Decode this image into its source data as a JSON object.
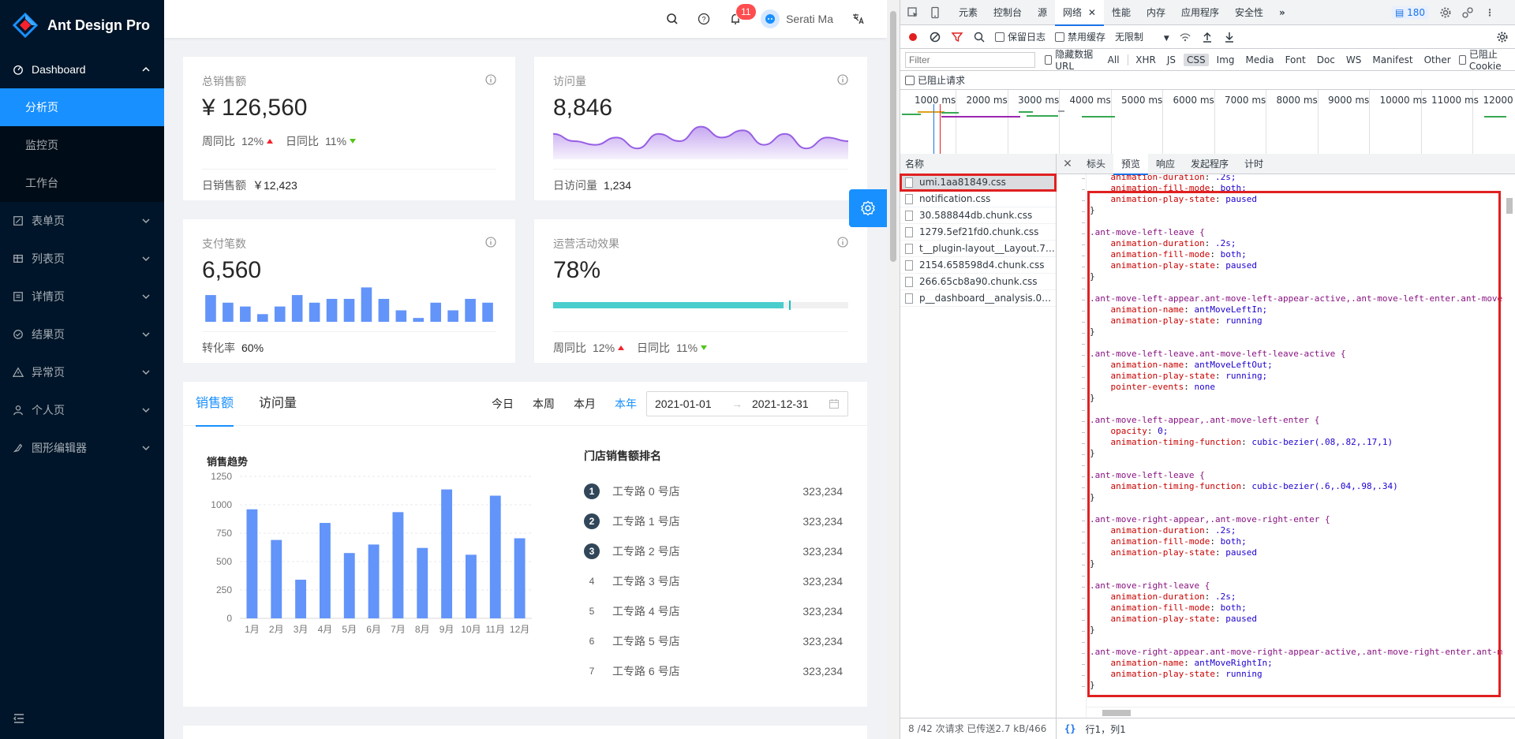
{
  "app": {
    "name": "Ant Design Pro"
  },
  "sidebar": {
    "items": [
      {
        "label": "Dashboard",
        "open": true,
        "icon": "dashboard-icon"
      },
      {
        "label": "表单页",
        "icon": "form-icon"
      },
      {
        "label": "列表页",
        "icon": "table-icon"
      },
      {
        "label": "详情页",
        "icon": "profile-icon"
      },
      {
        "label": "结果页",
        "icon": "check-circle-icon"
      },
      {
        "label": "异常页",
        "icon": "warning-icon"
      },
      {
        "label": "个人页",
        "icon": "user-icon"
      },
      {
        "label": "图形编辑器",
        "icon": "highlight-icon"
      }
    ],
    "subitems": [
      {
        "label": "分析页",
        "active": true
      },
      {
        "label": "监控页"
      },
      {
        "label": "工作台"
      }
    ]
  },
  "header": {
    "notice_count": "11",
    "user_name": "Serati Ma"
  },
  "stats": {
    "sales": {
      "title": "总销售额",
      "value": "¥ 126,560",
      "week_label": "周同比",
      "week_value": "12%",
      "day_label": "日同比",
      "day_value": "11%",
      "footer_label": "日销售额",
      "footer_value": "￥12,423"
    },
    "visits": {
      "title": "访问量",
      "value": "8,846",
      "footer_label": "日访问量",
      "footer_value": "1,234",
      "area_values": [
        7,
        5,
        4,
        6,
        3,
        7,
        5,
        9,
        6,
        8,
        4,
        7,
        3,
        6,
        5
      ]
    },
    "payments": {
      "title": "支付笔数",
      "value": "6,560",
      "footer_label": "转化率",
      "footer_value": "60%",
      "bar_values": [
        7,
        5,
        4,
        2,
        4,
        7,
        5,
        6,
        6,
        9,
        6,
        3,
        1,
        5,
        3,
        6,
        5
      ]
    },
    "operations": {
      "title": "运营活动效果",
      "value": "78%",
      "progress": 0.78,
      "target": 0.8,
      "week_label": "周同比",
      "week_value": "12%",
      "day_label": "日同比",
      "day_value": "11%"
    }
  },
  "sales_card": {
    "tabs": [
      "销售额",
      "访问量"
    ],
    "ranges": [
      "今日",
      "本周",
      "本月",
      "本年"
    ],
    "date_start": "2021-01-01",
    "date_sep": "→",
    "date_end": "2021-12-31",
    "rank_title": "门店销售额排名",
    "rank": [
      {
        "no": "1",
        "name": "工专路 0 号店",
        "value": "323,234"
      },
      {
        "no": "2",
        "name": "工专路 1 号店",
        "value": "323,234"
      },
      {
        "no": "3",
        "name": "工专路 2 号店",
        "value": "323,234"
      },
      {
        "no": "4",
        "name": "工专路 3 号店",
        "value": "323,234"
      },
      {
        "no": "5",
        "name": "工专路 4 号店",
        "value": "323,234"
      },
      {
        "no": "6",
        "name": "工专路 5 号店",
        "value": "323,234"
      },
      {
        "no": "7",
        "name": "工专路 6 号店",
        "value": "323,234"
      }
    ]
  },
  "chart_data": {
    "type": "bar",
    "title": "销售趋势",
    "categories": [
      "1月",
      "2月",
      "3月",
      "4月",
      "5月",
      "6月",
      "7月",
      "8月",
      "9月",
      "10月",
      "11月",
      "12月"
    ],
    "values": [
      960,
      690,
      340,
      840,
      575,
      650,
      935,
      620,
      1135,
      560,
      1080,
      705
    ],
    "ylim": [
      0,
      1250
    ],
    "yticks": [
      0,
      250,
      500,
      750,
      1000,
      1250
    ],
    "color": "#6294f9"
  },
  "devtools": {
    "tabs": [
      "元素",
      "控制台",
      "源",
      "网络",
      "性能",
      "内存",
      "应用程序",
      "安全性"
    ],
    "issues": "180",
    "toolbar": {
      "preserve_log": "保留日志",
      "disable_cache": "禁用缓存",
      "throttle": "无限制"
    },
    "filter_placeholder": "Filter",
    "hide_data_url": "隐藏数据 URL",
    "types": [
      "All",
      "XHR",
      "JS",
      "CSS",
      "Img",
      "Media",
      "Font",
      "Doc",
      "WS",
      "Manifest",
      "Other"
    ],
    "blocked_cookie": "已阻止 Cookie",
    "blocked_requests": "已阻止请求",
    "timeline_labels": [
      "1000 ms",
      "2000 ms",
      "3000 ms",
      "4000 ms",
      "5000 ms",
      "6000 ms",
      "7000 ms",
      "8000 ms",
      "9000 ms",
      "10000 ms",
      "11000 ms",
      "12000"
    ],
    "name_header": "名称",
    "files": [
      "umi.1aa81849.css",
      "notification.css",
      "30.588844db.chunk.css",
      "1279.5ef21fd0.chunk.css",
      "t__plugin-layout__Layout.7789...",
      "2154.658598d4.chunk.css",
      "266.65cb8a90.chunk.css",
      "p__dashboard__analysis.07df6f..."
    ],
    "preview_tabs": [
      "标头",
      "预览",
      "响应",
      "发起程序",
      "计时"
    ],
    "status_left": "8 /42 次请求  已传送2.7 kB/466 kB",
    "status_right": "行1，列1"
  },
  "code_lines": [
    "    animation-duration: .2s;",
    "    animation-fill-mode: both;",
    "    animation-play-state: paused",
    "}",
    "",
    ".ant-move-left-leave {",
    "    animation-duration: .2s;",
    "    animation-fill-mode: both;",
    "    animation-play-state: paused",
    "}",
    "",
    ".ant-move-left-appear.ant-move-left-appear-active,.ant-move-left-enter.ant-move",
    "    animation-name: antMoveLeftIn;",
    "    animation-play-state: running",
    "}",
    "",
    ".ant-move-left-leave.ant-move-left-leave-active {",
    "    animation-name: antMoveLeftOut;",
    "    animation-play-state: running;",
    "    pointer-events: none",
    "}",
    "",
    ".ant-move-left-appear,.ant-move-left-enter {",
    "    opacity: 0;",
    "    animation-timing-function: cubic-bezier(.08,.82,.17,1)",
    "}",
    "",
    ".ant-move-left-leave {",
    "    animation-timing-function: cubic-bezier(.6,.04,.98,.34)",
    "}",
    "",
    ".ant-move-right-appear,.ant-move-right-enter {",
    "    animation-duration: .2s;",
    "    animation-fill-mode: both;",
    "    animation-play-state: paused",
    "}",
    "",
    ".ant-move-right-leave {",
    "    animation-duration: .2s;",
    "    animation-fill-mode: both;",
    "    animation-play-state: paused",
    "}",
    "",
    ".ant-move-right-appear.ant-move-right-appear-active,.ant-move-right-enter.ant-m",
    "    animation-name: antMoveRightIn;",
    "    animation-play-state: running",
    "}"
  ]
}
